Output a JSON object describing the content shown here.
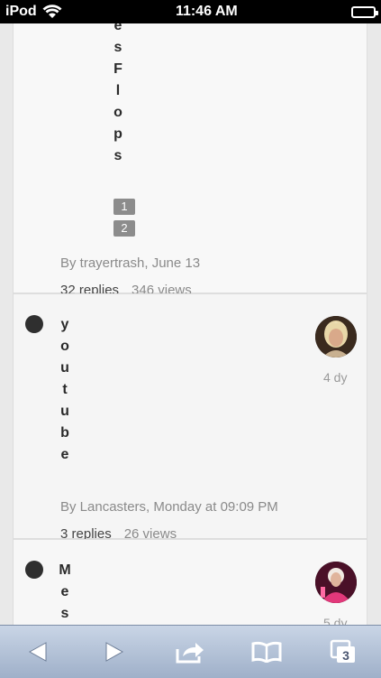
{
  "status_bar": {
    "carrier": "iPod",
    "time": "11:46 AM"
  },
  "threads": [
    {
      "title_letters_visible": [
        "e",
        "s",
        "F",
        "l",
        "o",
        "p",
        "s"
      ],
      "pages": [
        "1",
        "2"
      ],
      "byline": "By trayertrash, June 13",
      "replies": "32 replies",
      "views": "346 views"
    },
    {
      "title_letters_visible": [
        "y",
        "o",
        "u",
        "t",
        "u",
        "b",
        "e"
      ],
      "age": "4 dy",
      "byline": "By Lancasters, Monday at 09:09 PM",
      "replies": "3 replies",
      "views": "26 views"
    },
    {
      "title_letters_visible": [
        "M",
        "e",
        "s"
      ],
      "age": "5 dy"
    }
  ],
  "toolbar": {
    "tabs_count": "3",
    "icons": [
      "back-arrow-icon",
      "forward-arrow-icon",
      "share-icon",
      "bookmarks-icon",
      "tabs-icon"
    ]
  },
  "colors": {
    "status_bar_bg": "#000000",
    "toolbar_gradient_top": "#c9d5e6",
    "toolbar_gradient_bottom": "#9fb0c9",
    "unread_dot": "#2f2f2f"
  }
}
